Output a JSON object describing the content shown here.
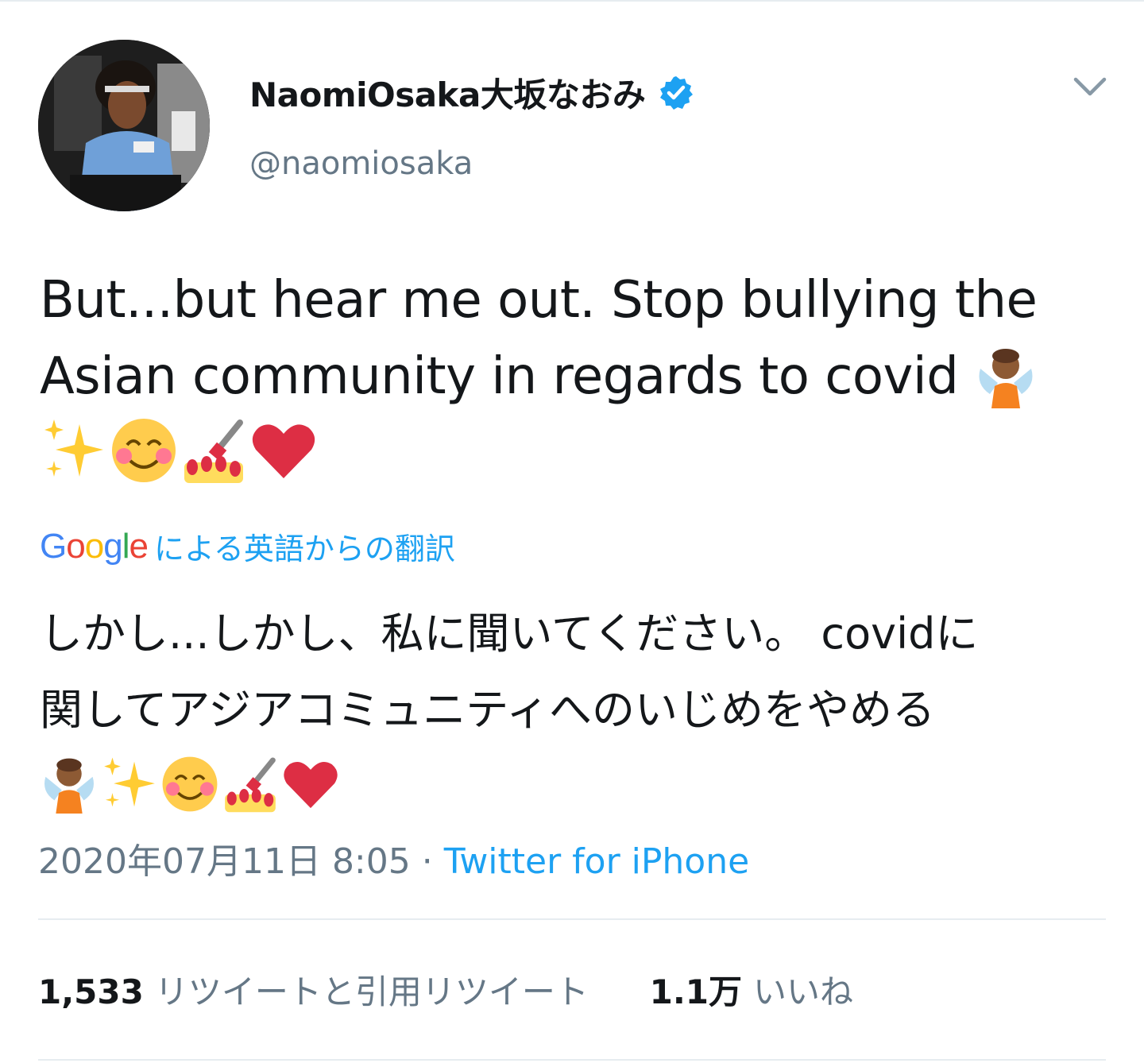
{
  "author": {
    "display_name": "NaomiOsaka大坂なおみ",
    "handle": "@naomiosaka",
    "verified": true,
    "avatar_icon": "profile-photo"
  },
  "tweet": {
    "line1": "But...but hear me out. Stop bullying the",
    "line2": "Asian community in regards to covid",
    "emojis": [
      "fairy-emoji",
      "sparkles-emoji",
      "smiling-face-emoji",
      "nail-polish-emoji",
      "red-heart-emoji"
    ]
  },
  "translation": {
    "google_label": "Google",
    "attribution": "による英語からの翻訳",
    "line1": "しかし...しかし、私に聞いてください。 covidに",
    "line2": "関してアジアコミュニティへのいじめをやめる"
  },
  "meta": {
    "timestamp": "2020年07月11日 8:05",
    "separator": " · ",
    "source": "Twitter for iPhone"
  },
  "stats": {
    "retweets_count": "1,533",
    "retweets_label": "リツイートと引用リツイート",
    "likes_count": "1.1万",
    "likes_label": "いいね"
  },
  "colors": {
    "accent": "#1da1f2",
    "text": "#14171a",
    "muted": "#657786",
    "divider": "#e6ecf0"
  }
}
